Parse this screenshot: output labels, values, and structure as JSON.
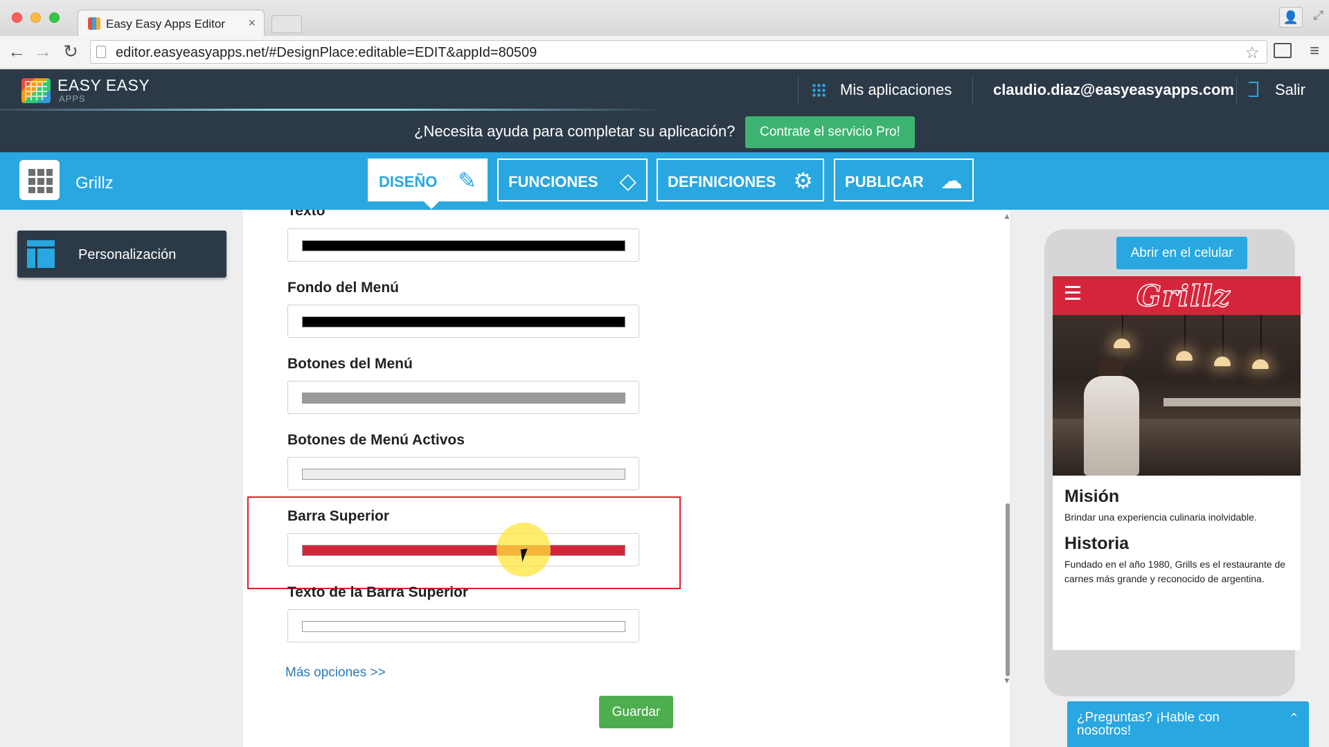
{
  "browser": {
    "tab_title": "Easy Easy Apps Editor",
    "tab_close": "×",
    "url": "editor.easyeasyapps.net/#DesignPlace:editable=EDIT&appId=80509",
    "back": "←",
    "forward": "→",
    "reload": "↻",
    "star": "☆",
    "menu": "≡",
    "profile": "👤",
    "fullscreen": "⤢"
  },
  "app_header": {
    "brand_name": "EASY EASY",
    "brand_sub": "APPS",
    "my_apps_label": "Mis aplicaciones",
    "user_email": "claudio.diaz@easyeasyapps.com",
    "logout_label": "Salir"
  },
  "help_bar": {
    "text": "¿Necesita ayuda para completar su aplicación?",
    "button_label": "Contrate el servicio Pro!"
  },
  "project": {
    "name": "Grillz"
  },
  "main_tabs": [
    {
      "label": "DISEÑO",
      "icon": "✎",
      "active": true
    },
    {
      "label": "FUNCIONES",
      "icon": "◇",
      "active": false
    },
    {
      "label": "DEFINICIONES",
      "icon": "⚙",
      "active": false
    },
    {
      "label": "PUBLICAR",
      "icon": "☁",
      "active": false
    }
  ],
  "sidebar": {
    "items": [
      {
        "label": "Personalización"
      }
    ]
  },
  "form": {
    "fields": [
      {
        "label": "Texto",
        "color": "#000000"
      },
      {
        "label": "Fondo del Menú",
        "color": "#000000"
      },
      {
        "label": "Botones del Menú",
        "color": "#9a9a9a"
      },
      {
        "label": "Botones de Menú Activos",
        "color": "#ececec"
      },
      {
        "label": "Barra Superior",
        "color": "#d5253b"
      },
      {
        "label": "Texto de la Barra Superior",
        "color": "#ffffff"
      }
    ],
    "more_options": "Más opciones >>",
    "save_label": "Guardar",
    "scroll_up": "▲",
    "scroll_down": "▼"
  },
  "preview": {
    "open_phone_label": "Abrir en el celular",
    "brand": "Grillz",
    "topbar_color": "#d5253b",
    "sections": [
      {
        "title": "Misión",
        "text": "Brindar una experiencia culinaria inolvidable."
      },
      {
        "title": "Historia",
        "text": "Fundado en el año 1980, Grills es el restaurante de carnes más grande y reconocido de argentina."
      }
    ]
  },
  "chat": {
    "text": "¿Preguntas? ¡Hable con nosotros!",
    "chevron": "⌃"
  },
  "colors": {
    "accent_blue": "#28a7e1",
    "header_dark": "#2c3a48",
    "green": "#3cb371",
    "highlight_red": "#e31e24"
  }
}
